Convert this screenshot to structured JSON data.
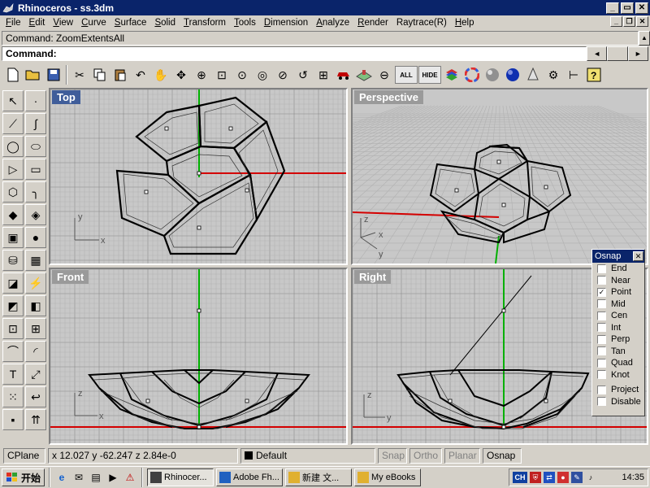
{
  "window": {
    "title": "Rhinoceros - ss.3dm"
  },
  "menu": [
    {
      "label": "File",
      "ul": "F",
      "rest": "ile"
    },
    {
      "label": "Edit",
      "ul": "E",
      "rest": "dit"
    },
    {
      "label": "View",
      "ul": "V",
      "rest": "iew"
    },
    {
      "label": "Curve",
      "ul": "C",
      "rest": "urve"
    },
    {
      "label": "Surface",
      "ul": "S",
      "rest": "urface"
    },
    {
      "label": "Solid",
      "ul": "S",
      "rest": "olid"
    },
    {
      "label": "Transform",
      "ul": "T",
      "rest": "ransform"
    },
    {
      "label": "Tools",
      "ul": "T",
      "rest": "ools"
    },
    {
      "label": "Dimension",
      "ul": "D",
      "rest": "imension"
    },
    {
      "label": "Analyze",
      "ul": "A",
      "rest": "nalyze"
    },
    {
      "label": "Render",
      "ul": "R",
      "rest": "ender"
    },
    {
      "label": "Raytrace(R)",
      "ul": "",
      "rest": "Raytrace(R)"
    },
    {
      "label": "Help",
      "ul": "H",
      "rest": "elp"
    }
  ],
  "command": {
    "history": "Command: ZoomExtentsAll",
    "prompt": "Command:"
  },
  "toolbar": {
    "all_label": "ALL",
    "hide_label": "HIDE"
  },
  "viewports": {
    "top": "Top",
    "perspective": "Perspective",
    "front": "Front",
    "right": "Right"
  },
  "osnap": {
    "title": "Osnap",
    "items": [
      {
        "label": "End",
        "checked": false
      },
      {
        "label": "Near",
        "checked": false
      },
      {
        "label": "Point",
        "checked": true
      },
      {
        "label": "Mid",
        "checked": false
      },
      {
        "label": "Cen",
        "checked": false
      },
      {
        "label": "Int",
        "checked": false
      },
      {
        "label": "Perp",
        "checked": false
      },
      {
        "label": "Tan",
        "checked": false
      },
      {
        "label": "Quad",
        "checked": false
      },
      {
        "label": "Knot",
        "checked": false
      }
    ],
    "extra": [
      {
        "label": "Project",
        "checked": false
      },
      {
        "label": "Disable",
        "checked": false
      }
    ]
  },
  "status": {
    "cplane": "CPlane",
    "coords": "x 12.027   y -62.247  z 2.84e-0",
    "layer": "Default",
    "snap": "Snap",
    "ortho": "Ortho",
    "planar": "Planar",
    "osnap": "Osnap"
  },
  "taskbar": {
    "start": "开始",
    "tasks": [
      "Rhinocer...",
      "Adobe Fh...",
      "新建 文...",
      "My eBooks"
    ],
    "clock": "14:35",
    "tray_ch": "CH"
  },
  "colors": {
    "titlebar": "#0a246a",
    "x_axis": "#d40000",
    "y_axis": "#00b000",
    "grid_bg": "#c8c8c8"
  }
}
